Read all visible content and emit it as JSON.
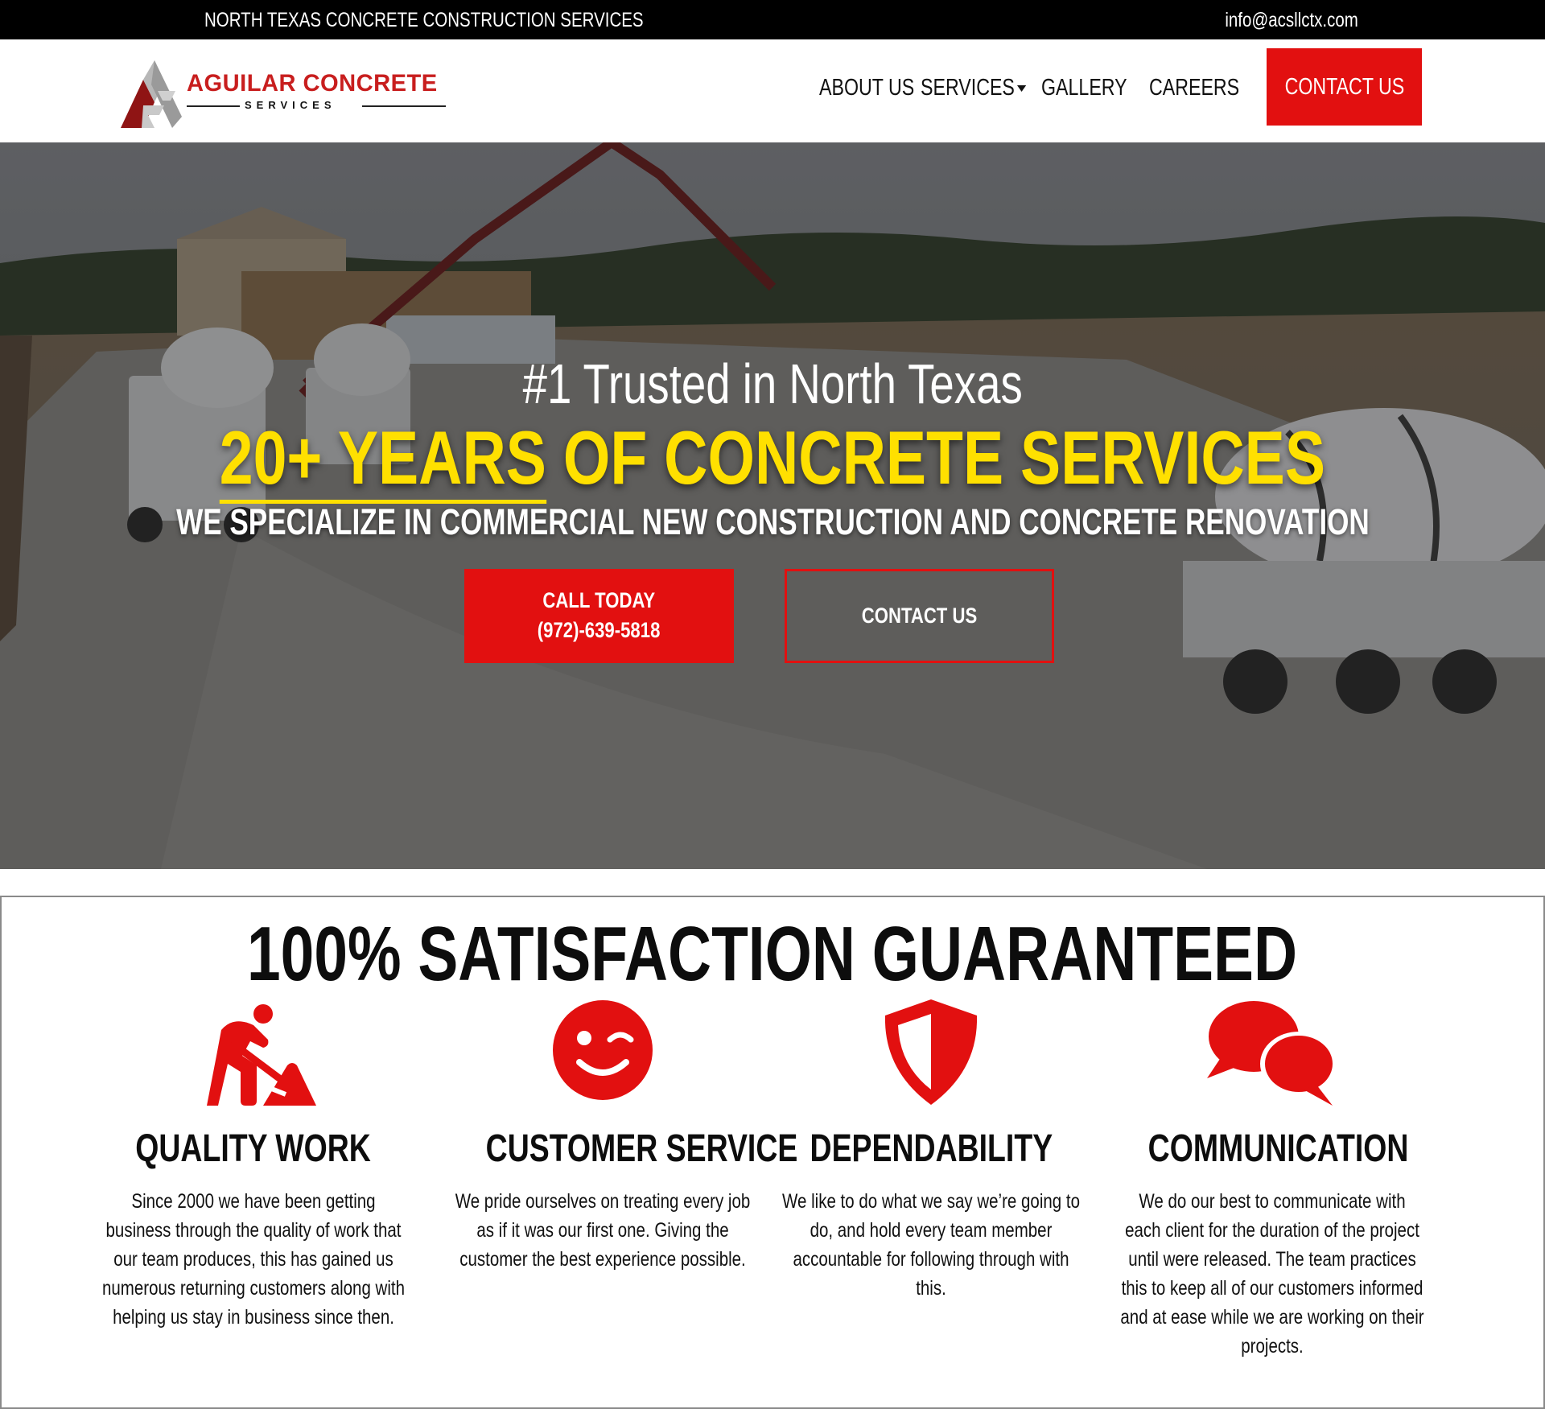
{
  "topbar": {
    "tagline": "NORTH TEXAS CONCRETE CONSTRUCTION SERVICES",
    "email": "info@acsllctx.com"
  },
  "header": {
    "logo": {
      "brand": "AGUILAR CONCRETE",
      "sub": "SERVICES"
    },
    "nav": [
      {
        "label": "ABOUT US"
      },
      {
        "label": "SERVICES",
        "has_dropdown": true
      },
      {
        "label": "GALLERY"
      },
      {
        "label": "CAREERS"
      }
    ],
    "contact_label": "CONTACT US"
  },
  "hero": {
    "kicker": "#1 Trusted in North Texas",
    "headline_underlined": "20+ YEARS",
    "headline_rest": " OF CONCRETE SERVICES",
    "subline": "WE SPECIALIZE IN COMMERCIAL NEW CONSTRUCTION AND CONCRETE RENOVATION",
    "call_line1": "CALL TODAY",
    "call_phone": "(972)-639-5818",
    "contact_label": "CONTACT US"
  },
  "satisfaction": {
    "title": "100% SATISFACTION GUARANTEED",
    "features": [
      {
        "icon": "worker-shoveling-icon",
        "title": "QUALITY WORK",
        "description": "Since 2000 we have been getting business through the quality of work that our team produces, this has gained us numerous returning customers along with helping us stay in business since then."
      },
      {
        "icon": "winking-smile-icon",
        "title": "CUSTOMER SERVICE",
        "description": "We pride ourselves on treating every job as if it was our first one. Giving the customer the best experience possible."
      },
      {
        "icon": "shield-icon",
        "title": "DEPENDABILITY",
        "description": "We like to do what we say we’re going to do, and hold every team member accountable for following through with this."
      },
      {
        "icon": "chat-bubbles-icon",
        "title": "COMMUNICATION",
        "description": "We do our best to communicate with each client for the duration of the project until were released. The team practices this to keep all of our customers informed and at ease while we are working on their projects."
      }
    ]
  },
  "colors": {
    "accent_red": "#e21010",
    "headline_yellow": "#ffe000",
    "topbar_black": "#000000"
  }
}
